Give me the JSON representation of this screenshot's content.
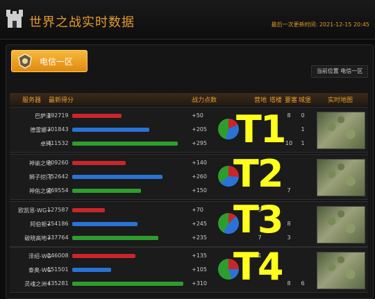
{
  "header": {
    "title": "世界之战实时数据",
    "update_label": "最后一次更新时间:",
    "update_time": "2021-12-15 20:45"
  },
  "server_button": {
    "label": "电信一区"
  },
  "location": {
    "text": "当前位置 电信一区"
  },
  "columns": [
    "服务器",
    "最新得分",
    "战力点数",
    "营地",
    "塔楼",
    "要塞",
    "城堡",
    "实时地图"
  ],
  "colors": {
    "red": "#c8262b",
    "blue": "#2a73d6",
    "green": "#2e9d2e",
    "accent": "#e39a2e"
  },
  "tiers": [
    {
      "label": "T1",
      "rows": [
        {
          "name": "巴萨泽",
          "score": "192719",
          "bar_value": 192719,
          "color": "red",
          "power": "+50",
          "camp": "",
          "tower": "",
          "fort": "8",
          "castle": "0"
        },
        {
          "name": "德雷娜+",
          "score": "301843",
          "bar_value": 301843,
          "color": "blue",
          "power": "+205",
          "camp": "",
          "tower": "",
          "fort": "",
          "castle": "1"
        },
        {
          "name": "卓玛",
          "score": "411532",
          "bar_value": 411532,
          "color": "green",
          "power": "+295",
          "camp": "",
          "tower": "",
          "fort": "10",
          "castle": "1"
        }
      ],
      "pie": [
        0.18,
        0.36,
        0.46
      ]
    },
    {
      "label": "T2",
      "rows": [
        {
          "name": "神谕之地",
          "score": "209260",
          "bar_value": 209260,
          "color": "red",
          "power": "+140",
          "camp": "",
          "tower": "",
          "fort": "",
          "castle": ""
        },
        {
          "name": "狮子挖门",
          "score": "352642",
          "bar_value": 352642,
          "color": "blue",
          "power": "+260",
          "camp": "",
          "tower": "",
          "fort": "",
          "castle": ""
        },
        {
          "name": "神佑之城",
          "score": "269554",
          "bar_value": 269554,
          "color": "green",
          "power": "+150",
          "camp": "",
          "tower": "",
          "fort": "7",
          "castle": ""
        }
      ],
      "pie": [
        0.26,
        0.38,
        0.36
      ]
    },
    {
      "label": "T3",
      "rows": [
        {
          "name": "欧凯恩-WG+",
          "score": "127587",
          "bar_value": 127587,
          "color": "red",
          "power": "+70",
          "camp": "5",
          "tower": "",
          "fort": "",
          "castle": ""
        },
        {
          "name": "阿伯顿+",
          "score": "254186",
          "bar_value": 254186,
          "color": "blue",
          "power": "+245",
          "camp": "",
          "tower": "",
          "fort": "8",
          "castle": ""
        },
        {
          "name": "破晓高地+",
          "score": "337764",
          "bar_value": 337764,
          "color": "green",
          "power": "+235",
          "camp": "7",
          "tower": "",
          "fort": "3",
          "castle": ""
        }
      ],
      "pie": [
        0.13,
        0.45,
        0.42
      ]
    },
    {
      "label": "T4",
      "rows": [
        {
          "name": "泽绍-WG",
          "score": "246008",
          "bar_value": 246008,
          "color": "red",
          "power": "+135",
          "camp": "1",
          "tower": "",
          "fort": "",
          "castle": ""
        },
        {
          "name": "泰奥-WG",
          "score": "151501",
          "bar_value": 151501,
          "color": "blue",
          "power": "+105",
          "camp": "",
          "tower": "",
          "fort": "",
          "castle": ""
        },
        {
          "name": "灵魂之洲+",
          "score": "435281",
          "bar_value": 435281,
          "color": "green",
          "power": "+310",
          "camp": "",
          "tower": "",
          "fort": "8",
          "castle": "6"
        }
      ],
      "pie": [
        0.25,
        0.2,
        0.55
      ]
    }
  ]
}
